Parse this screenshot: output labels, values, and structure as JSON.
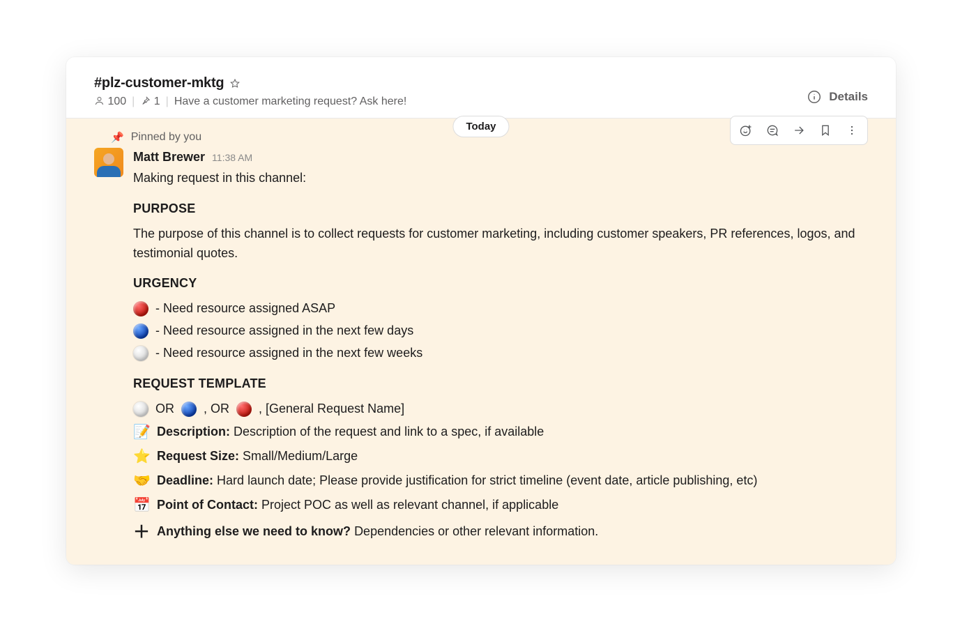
{
  "header": {
    "channel_name": "#plz-customer-mktg",
    "member_count": "100",
    "pin_count": "1",
    "topic": "Have a customer marketing request? Ask here!",
    "details_label": "Details"
  },
  "divider": {
    "today_label": "Today"
  },
  "pinned": {
    "label": "Pinned by you"
  },
  "message": {
    "author": "Matt Brewer",
    "timestamp": "11:38 AM",
    "intro": "Making request in this channel:",
    "purpose_title": "PURPOSE",
    "purpose_body": "The purpose of this channel is to collect requests for customer marketing, including customer speakers, PR references, logos, and testimonial quotes.",
    "urgency_title": "URGENCY",
    "urgency": [
      {
        "color": "red",
        "text": "- Need resource assigned ASAP"
      },
      {
        "color": "blue",
        "text": "- Need resource assigned in the next few days"
      },
      {
        "color": "white",
        "text": "- Need resource assigned in the next few weeks"
      }
    ],
    "template_title": "REQUEST TEMPLATE",
    "template": {
      "row1_or1": "OR",
      "row1_or2": ", OR",
      "row1_tail": ", [General Request Name]",
      "desc_label": "Description:",
      "desc_text": "Description of the request and link to a spec, if available",
      "size_label": "Request Size:",
      "size_text": "Small/Medium/Large",
      "deadline_label": "Deadline:",
      "deadline_text": "Hard launch date; Please provide justification for strict timeline (event date, article publishing, etc)",
      "poc_label": "Point of Contact:",
      "poc_text": "Project POC as well as relevant channel, if applicable",
      "else_label": "Anything else we need to know?",
      "else_text": "Dependencies or other relevant information."
    }
  }
}
